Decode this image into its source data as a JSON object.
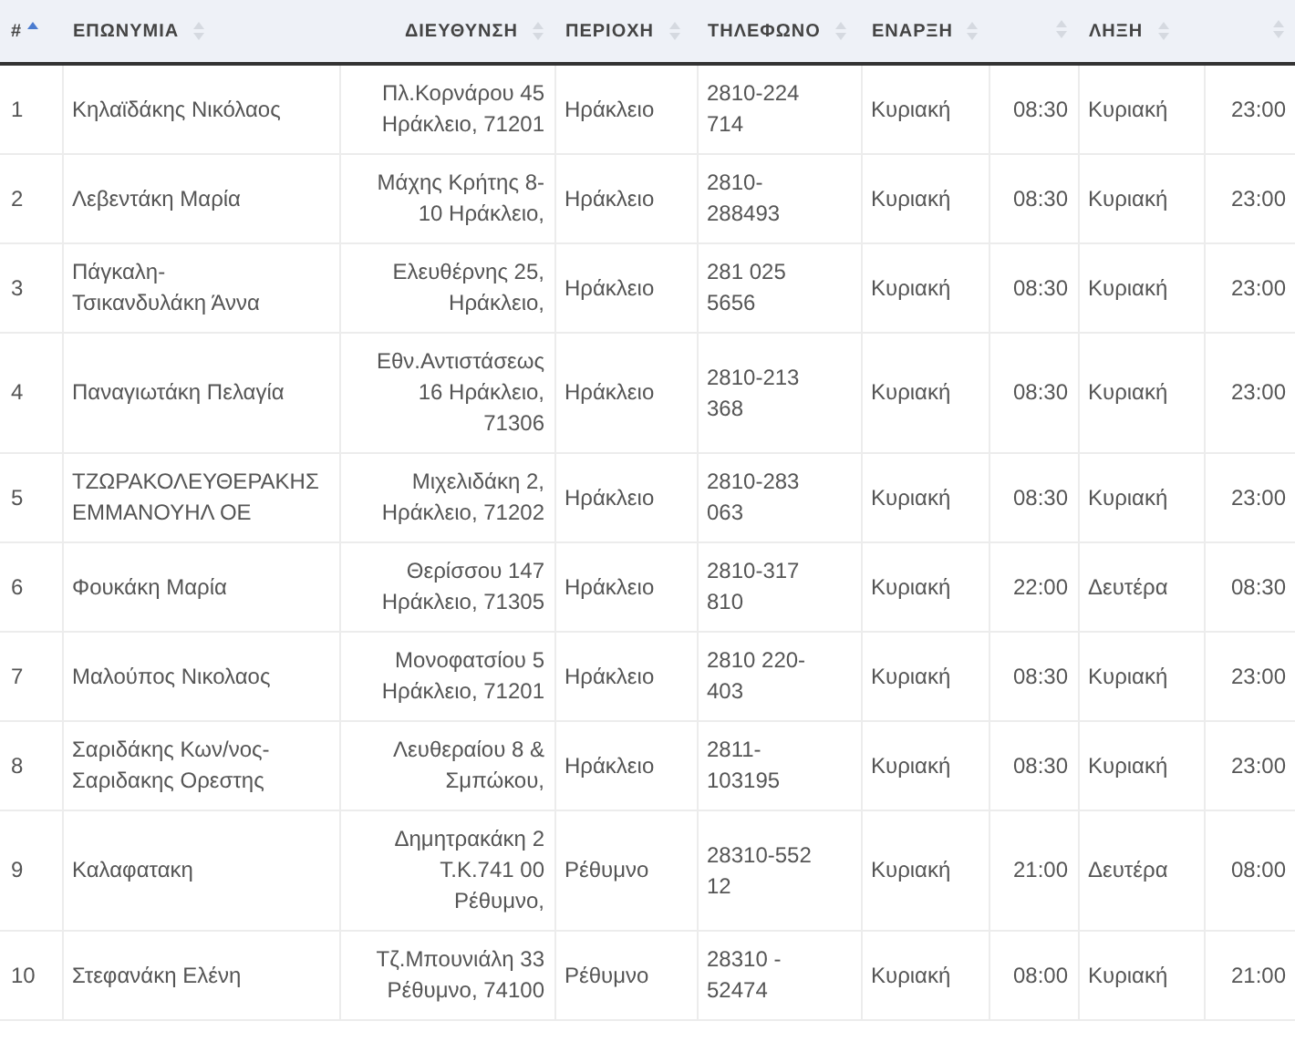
{
  "table": {
    "columns": [
      {
        "label": "#",
        "sorted": true
      },
      {
        "label": "ΕΠΩΝΥΜΙΑ",
        "sorted": false
      },
      {
        "label": "ΔΙΕΥΘΥΝΣΗ",
        "sorted": false
      },
      {
        "label": "ΠΕΡΙΟΧΗ",
        "sorted": false
      },
      {
        "label": "ΤΗΛΕΦΩΝΟ",
        "sorted": false
      },
      {
        "label": "ΕΝΑΡΞΗ",
        "sorted": false
      },
      {
        "sorted": false
      },
      {
        "label": "ΛΗΞΗ",
        "sorted": false
      },
      {
        "sorted": false
      }
    ],
    "rows": [
      [
        "1",
        "Κηλαϊδάκης Νικόλαος",
        "Πλ.Κορνάρου 45\nΗράκλειο, 71201",
        "Ηράκλειο",
        "2810-224\n714",
        "Κυριακή",
        "08:30",
        "Κυριακή",
        "23:00"
      ],
      [
        "2",
        "Λεβεντάκη Μαρία",
        "Μάχης Κρήτης 8-\n10 Ηράκλειο,",
        "Ηράκλειο",
        "2810-\n288493",
        "Κυριακή",
        "08:30",
        "Κυριακή",
        "23:00"
      ],
      [
        "3",
        "Πάγκαλη-\nΤσικανδυλάκη Άννα",
        "Ελευθέρνης 25,\nΗράκλειο,",
        "Ηράκλειο",
        "281 025\n5656",
        "Κυριακή",
        "08:30",
        "Κυριακή",
        "23:00"
      ],
      [
        "4",
        "Παναγιωτάκη Πελαγία",
        "Εθν.Αντιστάσεως\n16 Ηράκλειο,\n71306",
        "Ηράκλειο",
        "2810-213\n368",
        "Κυριακή",
        "08:30",
        "Κυριακή",
        "23:00"
      ],
      [
        "5",
        "ΤΖΩΡΑΚΟΛΕΥΘΕΡΑΚΗΣ\nΕΜΜΑΝΟΥΗΛ ΟΕ",
        "Μιχελιδάκη 2,\nΗράκλειο, 71202",
        "Ηράκλειο",
        "2810-283\n063",
        "Κυριακή",
        "08:30",
        "Κυριακή",
        "23:00"
      ],
      [
        "6",
        "Φουκάκη Μαρία",
        "Θερίσσου 147\nΗράκλειο, 71305",
        "Ηράκλειο",
        "2810-317\n810",
        "Κυριακή",
        "22:00",
        "Δευτέρα",
        "08:30"
      ],
      [
        "7",
        "Μαλούπος Νικολαος",
        "Μονοφατσίου 5\nΗράκλειο, 71201",
        "Ηράκλειο",
        "2810 220-\n403",
        "Κυριακή",
        "08:30",
        "Κυριακή",
        "23:00"
      ],
      [
        "8",
        "Σαριδάκης Κων/νος-\nΣαριδακης Ορεστης",
        "Λευθεραίου 8 &\nΣμπώκου,",
        "Ηράκλειο",
        "2811-\n103195",
        "Κυριακή",
        "08:30",
        "Κυριακή",
        "23:00"
      ],
      [
        "9",
        "Καλαφατακη",
        "Δημητρακάκη 2\nΤ.Κ.741 00\nΡέθυμνο,",
        "Ρέθυμνο",
        "28310-552\n12",
        "Κυριακή",
        "21:00",
        "Δευτέρα",
        "08:00"
      ],
      [
        "10",
        "Στεφανάκη Ελένη",
        "Τζ.Μπουνιάλη 33\nΡέθυμνο, 74100",
        "Ρέθυμνο",
        "28310 -\n52474",
        "Κυριακή",
        "08:00",
        "Κυριακή",
        "21:00"
      ]
    ]
  }
}
